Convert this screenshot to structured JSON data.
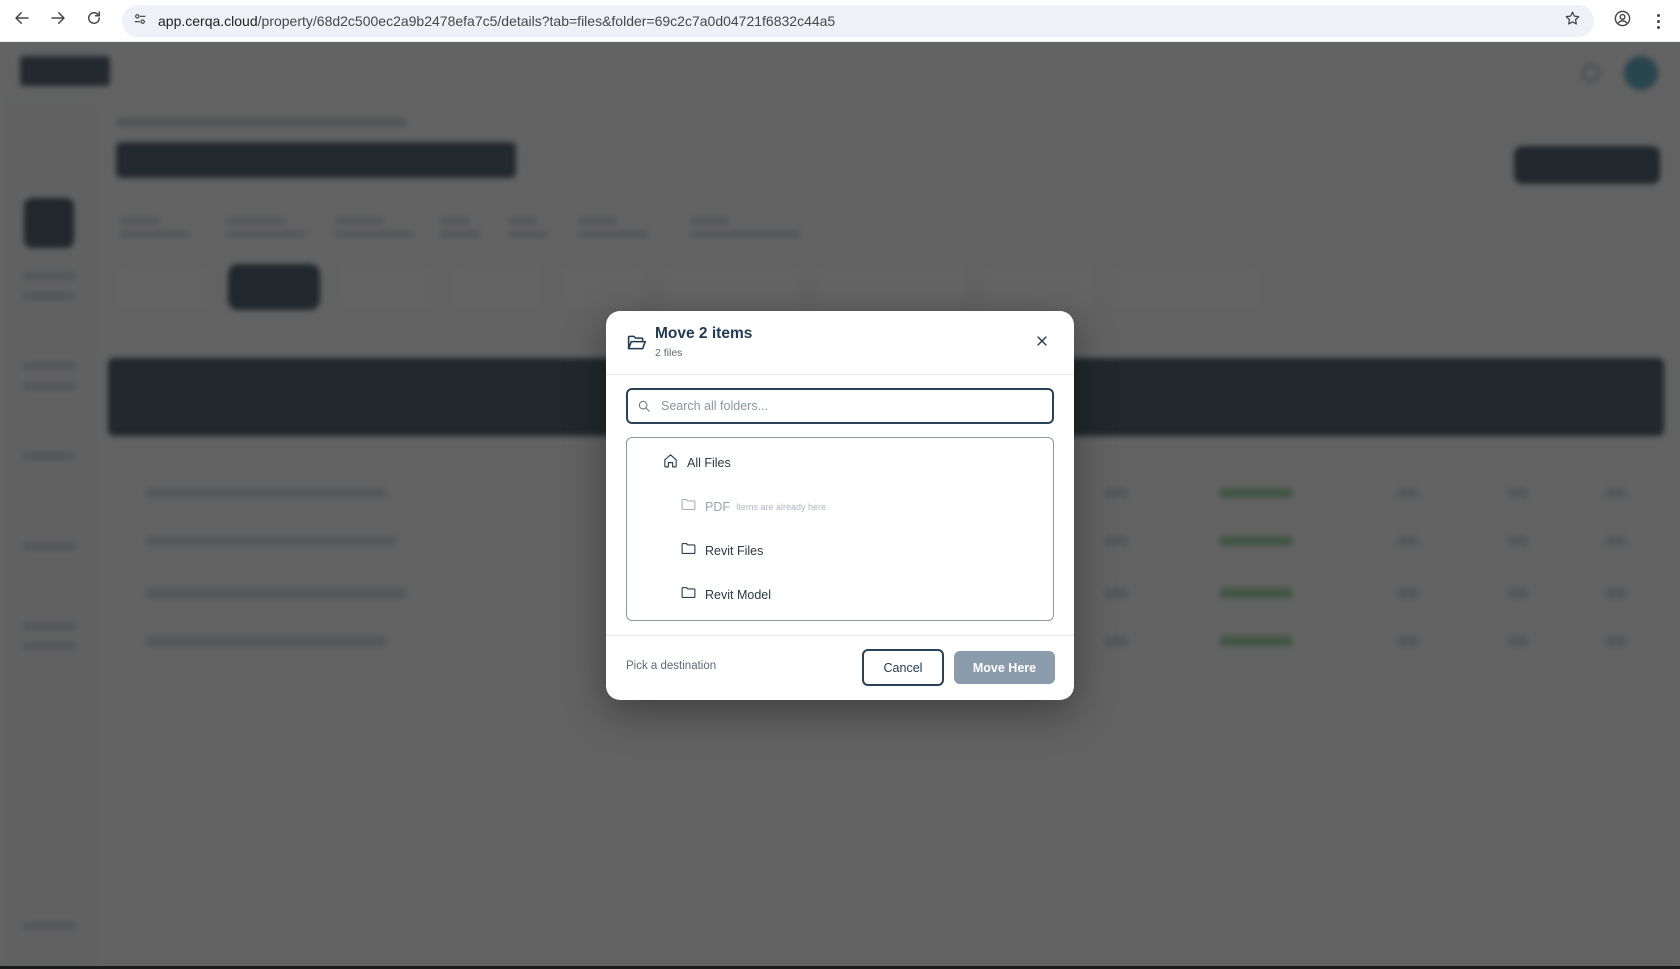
{
  "browser": {
    "url_host": "app.cerqa.cloud",
    "url_path": "/property/68d2c500ec2a9b2478efa7c5/details?tab=files&folder=69c2c7a0d04721f6832c44a5"
  },
  "icons": {
    "back": "arrow-left-icon",
    "forward": "arrow-right-icon",
    "reload": "reload-icon",
    "site_info": "tune-icon",
    "bookmark": "star-icon",
    "profile": "account-circle-icon",
    "menu": "kebab-menu-icon",
    "modal": "folder-open-icon",
    "close": "close-icon",
    "search": "search-icon",
    "root": "home-icon",
    "folder": "folder-icon"
  },
  "modal": {
    "title": "Move 2 items",
    "subtitle": "2 files",
    "search_placeholder": "Search all folders...",
    "root_label": "All Files",
    "folders": [
      {
        "label": "PDF",
        "note": "Items are already here",
        "disabled": true
      },
      {
        "label": "Revit Files",
        "note": "",
        "disabled": false
      },
      {
        "label": "Revit Model",
        "note": "",
        "disabled": false
      }
    ],
    "footer_hint": "Pick a destination",
    "cancel_label": "Cancel",
    "move_label": "Move Here"
  },
  "colors": {
    "primary": "#1f3a52",
    "overlay": "#282828",
    "move_button_disabled": "#8b9cac"
  }
}
